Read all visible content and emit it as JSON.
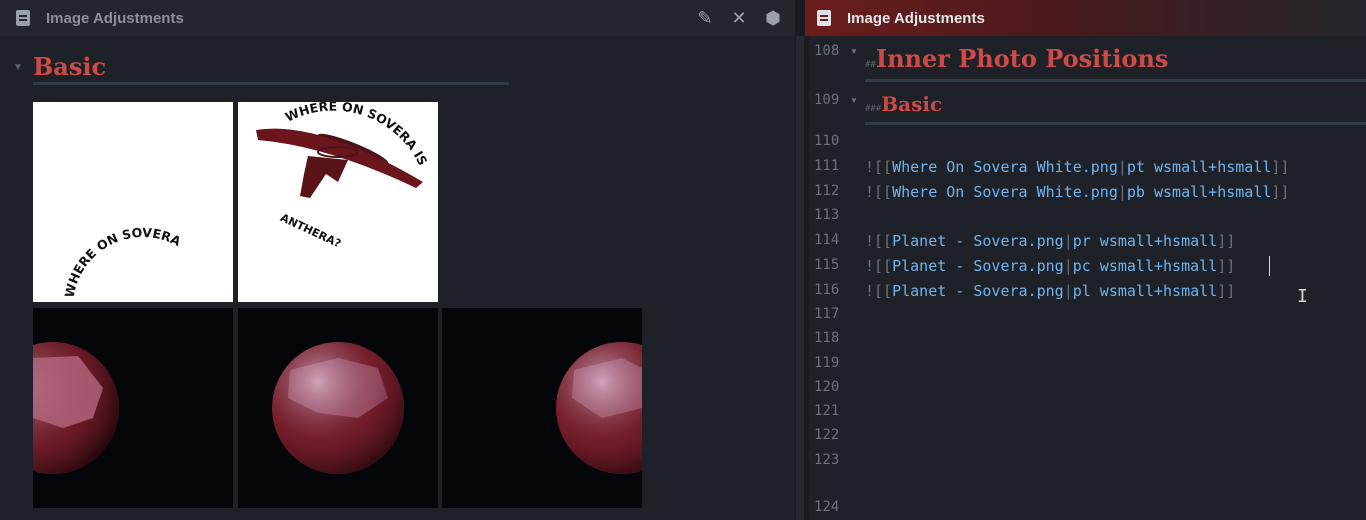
{
  "left_pane": {
    "tab_title": "Image Adjustments",
    "tab_icons": [
      "file-text-icon",
      "pencil-icon",
      "close-icon",
      "gear-icon"
    ],
    "preview_heading": "Basic",
    "tiles_row1": [
      {
        "name": "where-on-sovera-top-crop",
        "text_top": "WHERE ON SOVERA IS",
        "text_bottom": "ANTHERA?"
      },
      {
        "name": "where-on-sovera-bottom-crop",
        "text_bottom": "WHERE ON SOVERA"
      }
    ]
  },
  "right_pane": {
    "tab_title": "Image Adjustments",
    "lines": [
      {
        "n": "108",
        "fold": true,
        "kind": "h2",
        "hashes": "##",
        "text": "Inner Photo Positions"
      },
      {
        "n": "109",
        "fold": true,
        "kind": "h3",
        "hashes": "###",
        "text": "Basic"
      },
      {
        "n": "110",
        "kind": "blank"
      },
      {
        "n": "111",
        "kind": "embed",
        "target": "Where On Sovera White.png",
        "param": "pt wsmall+hsmall"
      },
      {
        "n": "112",
        "kind": "embed",
        "target": "Where On Sovera White.png",
        "param": "pb wsmall+hsmall"
      },
      {
        "n": "113",
        "kind": "blank"
      },
      {
        "n": "114",
        "kind": "embed",
        "target": "Planet - Sovera.png",
        "param": "pr wsmall+hsmall"
      },
      {
        "n": "115",
        "kind": "embed",
        "target": "Planet - Sovera.png",
        "param": "pc wsmall+hsmall"
      },
      {
        "n": "116",
        "kind": "embed",
        "target": "Planet - Sovera.png",
        "param": "pl wsmall+hsmall"
      },
      {
        "n": "117",
        "kind": "blank"
      },
      {
        "n": "118",
        "kind": "blank"
      },
      {
        "n": "119",
        "kind": "blank"
      },
      {
        "n": "120",
        "kind": "blank"
      },
      {
        "n": "121",
        "kind": "blank"
      },
      {
        "n": "122",
        "kind": "blank"
      },
      {
        "n": "123",
        "kind": "blank"
      },
      {
        "n": "124",
        "kind": "blank"
      }
    ]
  },
  "colors": {
    "heading_red": "#cd4a47",
    "link_blue": "#6fb3ef",
    "planet_red": "#7a1f2a"
  }
}
